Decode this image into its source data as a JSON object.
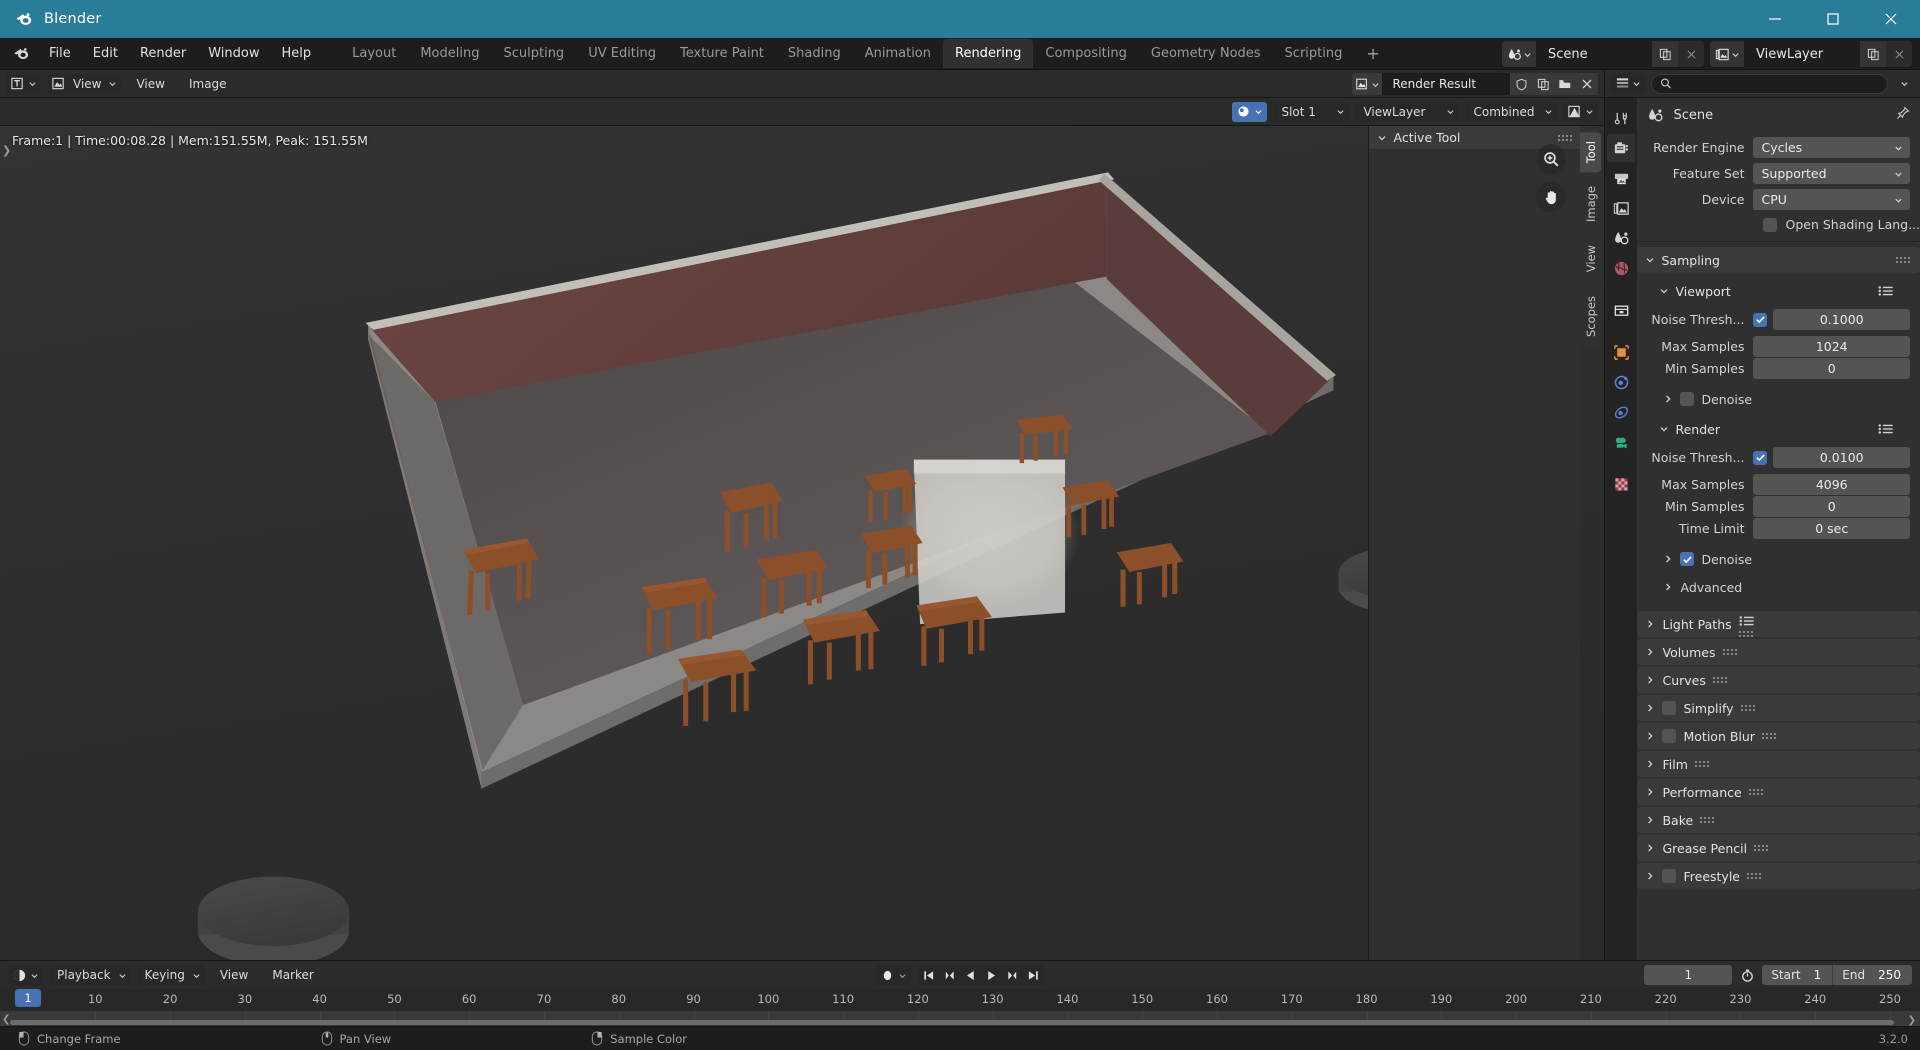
{
  "window": {
    "title": "Blender",
    "minimize": "minimize-icon",
    "maximize": "maximize-icon",
    "close": "close-icon"
  },
  "menubar": {
    "items": [
      "File",
      "Edit",
      "Render",
      "Window",
      "Help"
    ],
    "workspaces": [
      {
        "label": "Layout",
        "active": false
      },
      {
        "label": "Modeling",
        "active": false
      },
      {
        "label": "Sculpting",
        "active": false
      },
      {
        "label": "UV Editing",
        "active": false
      },
      {
        "label": "Texture Paint",
        "active": false
      },
      {
        "label": "Shading",
        "active": false
      },
      {
        "label": "Animation",
        "active": false
      },
      {
        "label": "Rendering",
        "active": true
      },
      {
        "label": "Compositing",
        "active": false
      },
      {
        "label": "Geometry Nodes",
        "active": false
      },
      {
        "label": "Scripting",
        "active": false
      }
    ],
    "add_workspace": "+",
    "scene_name": "Scene",
    "viewlayer_name": "ViewLayer"
  },
  "image_editor": {
    "header": {
      "editor_type": "image-editor-icon",
      "view_mode": "View",
      "menus": [
        "View",
        "Image"
      ],
      "image_name": "Render Result",
      "buttons": [
        "fake-user-icon",
        "new-image-icon",
        "open-image-icon",
        "unlink-icon"
      ]
    },
    "stats": "Frame:1 | Time:00:08.28 | Mem:151.55M, Peak: 151.55M",
    "render_slot": "Slot 1",
    "view_layer": "ViewLayer",
    "pass": "Combined",
    "display_channels": "display-channels-icon",
    "gizmos": [
      "zoom-gizmo",
      "pan-gizmo"
    ],
    "sidebar": {
      "panel_title": "Active Tool",
      "tabs": [
        {
          "label": "Tool",
          "active": true
        },
        {
          "label": "Image",
          "active": false
        },
        {
          "label": "View",
          "active": false
        },
        {
          "label": "Scopes",
          "active": false
        }
      ]
    }
  },
  "properties": {
    "search_placeholder": "",
    "breadcrumb": "Scene",
    "tabs": [
      {
        "name": "tool-tab",
        "active": false
      },
      {
        "name": "render-tab",
        "active": true
      },
      {
        "name": "output-tab",
        "active": false
      },
      {
        "name": "view-layer-tab",
        "active": false
      },
      {
        "name": "scene-tab",
        "active": false
      },
      {
        "name": "world-tab",
        "active": false
      },
      {
        "name": "collection-tab",
        "active": false
      },
      {
        "name": "object-tab",
        "active": false
      },
      {
        "name": "modifiers-tab",
        "active": false
      },
      {
        "name": "physics-tab",
        "active": false
      },
      {
        "name": "object-constraints-tab",
        "active": false
      },
      {
        "name": "material-tab",
        "active": false
      }
    ],
    "render_engine": {
      "label": "Render Engine",
      "value": "Cycles"
    },
    "feature_set": {
      "label": "Feature Set",
      "value": "Supported"
    },
    "device": {
      "label": "Device",
      "value": "CPU"
    },
    "osl": {
      "label": "Open Shading Lang...",
      "checked": false
    },
    "sampling": {
      "title": "Sampling",
      "viewport": {
        "title": "Viewport",
        "noise_threshold": {
          "label": "Noise Thresh...",
          "checked": true,
          "value": "0.1000"
        },
        "max_samples": {
          "label": "Max Samples",
          "value": "1024"
        },
        "min_samples": {
          "label": "Min Samples",
          "value": "0"
        },
        "denoise": {
          "label": "Denoise",
          "checked": false
        }
      },
      "render": {
        "title": "Render",
        "noise_threshold": {
          "label": "Noise Thresh...",
          "checked": true,
          "value": "0.0100"
        },
        "max_samples": {
          "label": "Max Samples",
          "value": "4096"
        },
        "min_samples": {
          "label": "Min Samples",
          "value": "0"
        },
        "time_limit": {
          "label": "Time Limit",
          "value": "0 sec"
        },
        "denoise": {
          "label": "Denoise",
          "checked": true
        }
      },
      "advanced": {
        "label": "Advanced"
      }
    },
    "panels": [
      {
        "label": "Light Paths",
        "checkbox": false,
        "has_preset": true
      },
      {
        "label": "Volumes",
        "checkbox": false,
        "has_preset": false
      },
      {
        "label": "Curves",
        "checkbox": false,
        "has_preset": false
      },
      {
        "label": "Simplify",
        "checkbox": true,
        "checked": false,
        "has_preset": false
      },
      {
        "label": "Motion Blur",
        "checkbox": true,
        "checked": false,
        "has_preset": false
      },
      {
        "label": "Film",
        "checkbox": false,
        "has_preset": false
      },
      {
        "label": "Performance",
        "checkbox": false,
        "has_preset": false
      },
      {
        "label": "Bake",
        "checkbox": false,
        "has_preset": false
      },
      {
        "label": "Grease Pencil",
        "checkbox": false,
        "has_preset": false
      },
      {
        "label": "Freestyle",
        "checkbox": true,
        "checked": false,
        "has_preset": false
      }
    ]
  },
  "timeline": {
    "editor_icon": "timeline-editor-icon",
    "menus": [
      "Playback",
      "Keying",
      "View",
      "Marker"
    ],
    "record_icon": "auto-keying-icon",
    "playback_buttons": [
      "jump-to-start-icon",
      "jump-to-keyframe-prev-icon",
      "play-reverse-icon",
      "play-icon",
      "jump-to-keyframe-next-icon",
      "jump-to-end-icon"
    ],
    "current_frame": "1",
    "use_preview_range_icon": "stopwatch-icon",
    "start_label": "Start",
    "start_value": "1",
    "end_label": "End",
    "end_value": "250",
    "ticks": [
      1,
      10,
      20,
      30,
      40,
      50,
      60,
      70,
      80,
      90,
      100,
      110,
      120,
      130,
      140,
      150,
      160,
      170,
      180,
      190,
      200,
      210,
      220,
      230,
      240,
      250
    ],
    "playhead_frame": "1"
  },
  "statusbar": {
    "hints": [
      {
        "icon": "mouse-left-icon",
        "text": "Change Frame"
      },
      {
        "icon": "mouse-middle-icon",
        "text": "Pan View"
      },
      {
        "icon": "mouse-right-icon",
        "text": "Sample Color"
      }
    ],
    "version": "3.2.0"
  },
  "colors": {
    "title_bar": "#2a7d99",
    "accent_blue": "#4772b3",
    "wall_red": "#6b4542",
    "table_wood": "#8a4d28",
    "floor_gray": "#5a5555"
  }
}
